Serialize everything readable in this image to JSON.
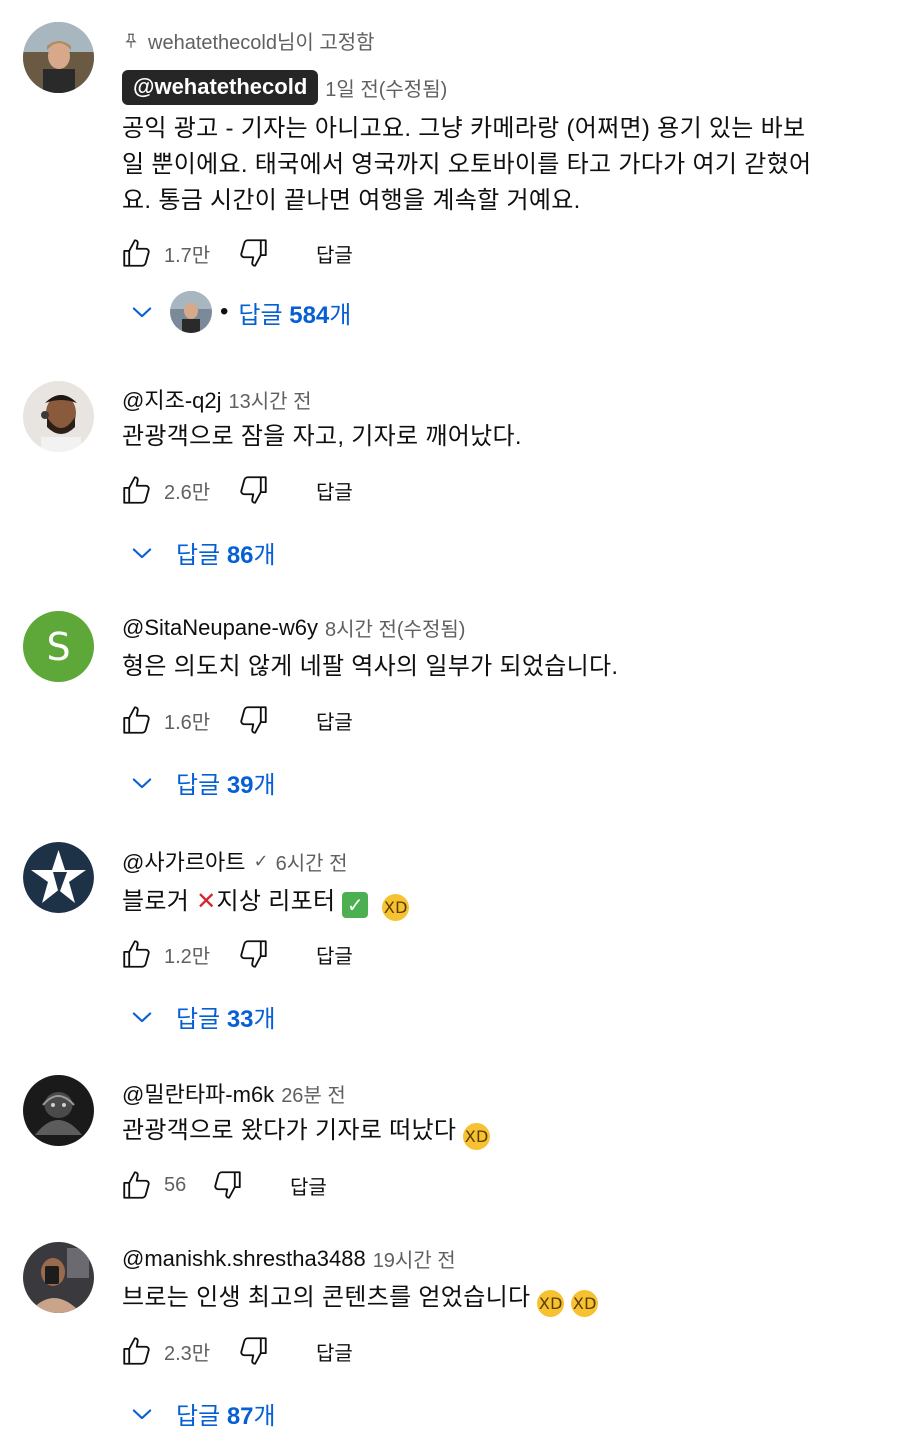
{
  "comments": [
    {
      "pinned_text": "wehatethecold님이 고정함",
      "author": "@wehatethecold",
      "time": "1일 전(수정됨)",
      "text_lines": [
        "공익 광고 - 기자는 아니고요. 그냥 카메라랑 (어쩌면) 용기 있는 바보",
        "일 뿐이에요. 태국에서 영국까지 오토바이를 타고 가다가 여기 갇혔어",
        "요. 통금 시간이 끝나면 여행을 계속할 거예요."
      ],
      "likes": "1.7만",
      "reply_label": "답글",
      "replies_count": "584",
      "replies_prefix": "답글 ",
      "replies_suffix": "개",
      "replies_dot": "•"
    },
    {
      "author": "@지조-q2j",
      "time": "13시간 전",
      "text": "관광객으로 잠을 자고, 기자로 깨어났다.",
      "likes": "2.6만",
      "reply_label": "답글",
      "replies_prefix": "답글 ",
      "replies_count": "86",
      "replies_suffix": "개"
    },
    {
      "author": "@SitaNeupane-w6y",
      "avatar_letter": "S",
      "time": "8시간 전(수정됨)",
      "text": "형은 의도치 않게 네팔 역사의 일부가 되었습니다.",
      "likes": "1.6만",
      "reply_label": "답글",
      "replies_prefix": "답글 ",
      "replies_count": "39",
      "replies_suffix": "개"
    },
    {
      "author": "@사가르아트",
      "verified": "✓",
      "time": "6시간 전",
      "text_a": "블로거 ",
      "text_b": "지상 리포터 ",
      "emoji_x": "✕",
      "emoji_check": "✓",
      "emoji_laugh": "😂",
      "likes": "1.2만",
      "reply_label": "답글",
      "replies_prefix": "답글 ",
      "replies_count": "33",
      "replies_suffix": "개"
    },
    {
      "author": "@밀란타파-m6k",
      "time": "26분 전",
      "text": "관광객으로 왔다가 기자로 떠났다 ",
      "emoji_laugh": "😂",
      "likes": "56",
      "reply_label": "답글"
    },
    {
      "author": "@manishk.shrestha3488",
      "time": "19시간 전",
      "text": "브로는 인생 최고의 콘텐츠를 얻었습니다 ",
      "emoji_laugh": "😂",
      "likes": "2.3만",
      "reply_label": "답글",
      "replies_prefix": "답글 ",
      "replies_count": "87",
      "replies_suffix": "개"
    }
  ],
  "colors": {
    "link_blue": "#065fd4",
    "meta_gray": "#606060",
    "letter_avatar_green": "#5ea83a",
    "pinned_author_bg": "#262626"
  },
  "icons": [
    "pin-icon",
    "thumbs-up-icon",
    "thumbs-down-icon",
    "chevron-down-icon"
  ]
}
